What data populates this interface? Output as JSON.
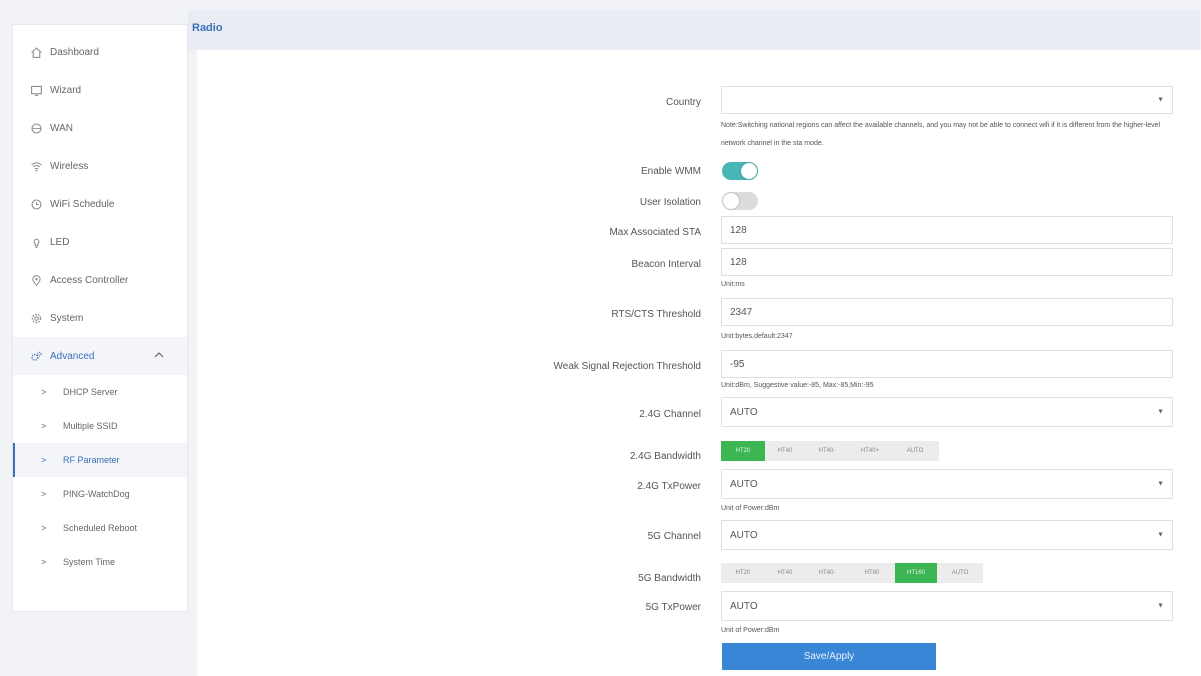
{
  "page": {
    "title": "Radio"
  },
  "colors": {
    "accent": "#3a6fb8",
    "toggle_on": "#46b6b6",
    "segment_selected": "#3cb553",
    "button": "#3a86d6"
  },
  "sidebar": {
    "items": [
      {
        "label": "Dashboard",
        "icon": "home-icon"
      },
      {
        "label": "Wizard",
        "icon": "monitor-icon"
      },
      {
        "label": "WAN",
        "icon": "globe-icon"
      },
      {
        "label": "Wireless",
        "icon": "wifi-icon"
      },
      {
        "label": "WiFi Schedule",
        "icon": "clock-icon"
      },
      {
        "label": "LED",
        "icon": "bulb-icon"
      },
      {
        "label": "Access Controller",
        "icon": "location-pin-icon"
      },
      {
        "label": "System",
        "icon": "gear-icon"
      },
      {
        "label": "Advanced",
        "icon": "gears-icon",
        "expanded": true
      }
    ],
    "subitems": [
      {
        "label": "DHCP Server"
      },
      {
        "label": "Multiple SSID"
      },
      {
        "label": "RF Parameter",
        "active": true
      },
      {
        "label": "PING-WatchDog"
      },
      {
        "label": "Scheduled Reboot"
      },
      {
        "label": "System Time"
      }
    ]
  },
  "form": {
    "country": {
      "label": "Country",
      "value": ""
    },
    "country_note": "Note:Switching national regions can affect the available channels, and you may not be able to connect wifi if it is different from the higher-level network channel in the sta mode.",
    "enable_wmm": {
      "label": "Enable WMM",
      "on": true
    },
    "user_isolation": {
      "label": "User Isolation",
      "on": false
    },
    "max_sta": {
      "label": "Max Associated STA",
      "value": "128"
    },
    "beacon": {
      "label": "Beacon Interval",
      "value": "128",
      "hint": "Unit:ms"
    },
    "rts": {
      "label": "RTS/CTS Threshold",
      "value": "2347",
      "hint": "Unit:bytes,default:2347"
    },
    "weak_signal": {
      "label": "Weak Signal Rejection Threshold",
      "value": "-95",
      "hint": "Unit:dBm, Suggestive value:-85, Max:-85,Min:-95"
    },
    "ch24": {
      "label": "2.4G Channel",
      "value": "AUTO"
    },
    "bw24": {
      "label": "2.4G Bandwidth",
      "options": [
        "HT20",
        "HT40",
        "HT40-",
        "HT40+",
        "AUTO"
      ],
      "selected": "HT20"
    },
    "tx24": {
      "label": "2.4G TxPower",
      "value": "AUTO",
      "hint": "Unit of Power:dBm"
    },
    "ch5": {
      "label": "5G Channel",
      "value": "AUTO"
    },
    "bw5": {
      "label": "5G Bandwidth",
      "options": [
        "HT20",
        "HT40",
        "HT40-",
        "HT80",
        "HT160",
        "AUTO"
      ],
      "selected": "HT160"
    },
    "tx5": {
      "label": "5G TxPower",
      "value": "AUTO",
      "hint": "Unit of Power:dBm"
    },
    "save_label": "Save/Apply"
  }
}
